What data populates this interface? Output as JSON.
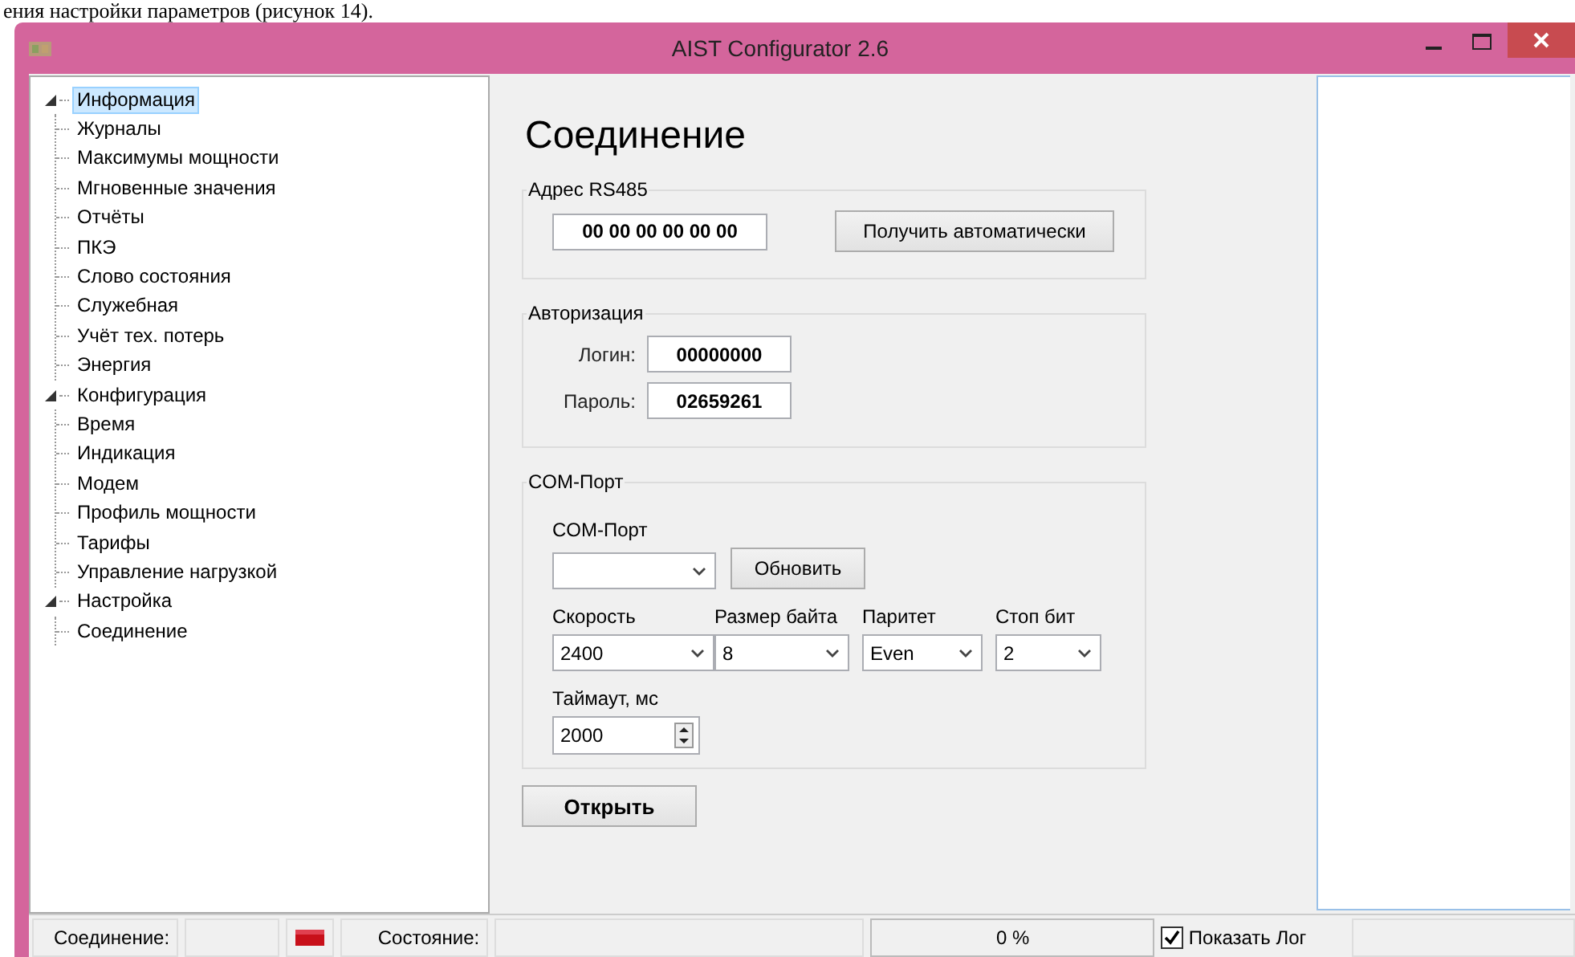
{
  "document_text": "ения настройки параметров (рисунок 14).",
  "window": {
    "title": "AIST Configurator 2.6"
  },
  "tree": [
    {
      "label": "Информация",
      "selected": true,
      "expanded": true,
      "children": [
        {
          "label": "Журналы",
          "selected": false
        },
        {
          "label": "Максимумы мощности",
          "selected": false
        },
        {
          "label": "Мгновенные значения",
          "selected": false
        },
        {
          "label": "Отчёты",
          "selected": false
        },
        {
          "label": "ПКЭ",
          "selected": false
        },
        {
          "label": "Слово состояния",
          "selected": false
        },
        {
          "label": "Служебная",
          "selected": false
        },
        {
          "label": "Учёт тех. потерь",
          "selected": false
        },
        {
          "label": "Энергия",
          "selected": false
        }
      ]
    },
    {
      "label": "Конфигурация",
      "selected": false,
      "expanded": true,
      "children": [
        {
          "label": "Время",
          "selected": false
        },
        {
          "label": "Индикация",
          "selected": false
        },
        {
          "label": "Модем",
          "selected": false
        },
        {
          "label": "Профиль мощности",
          "selected": false
        },
        {
          "label": "Тарифы",
          "selected": false
        },
        {
          "label": "Управление нагрузкой",
          "selected": false
        }
      ]
    },
    {
      "label": "Настройка",
      "selected": false,
      "expanded": true,
      "children": [
        {
          "label": "Соединение",
          "selected": false
        }
      ]
    }
  ],
  "page": {
    "title": "Соединение",
    "rs485_group": {
      "title": "Адрес RS485",
      "address": "00 00 00 00 00 00",
      "button": "Получить автоматически"
    },
    "auth_group": {
      "title": "Авторизация",
      "fields": [
        {
          "label": "Логин:",
          "value": "00000000"
        },
        {
          "label": "Пароль:",
          "value": "02659261"
        }
      ]
    },
    "com_group": {
      "title": "COM-Порт",
      "port_label": "COM-Порт",
      "refresh_button": "Обновить",
      "selects": [
        {
          "label": "Скорость",
          "value": "2400"
        },
        {
          "label": "Размер байта",
          "value": "8"
        },
        {
          "label": "Паритет",
          "value": "Even"
        },
        {
          "label": "Стоп бит",
          "value": "2"
        }
      ],
      "timeout": {
        "label": "Таймаут, мс",
        "value": "2000"
      }
    },
    "open_button": "Открыть"
  },
  "status_bar": {
    "connection_label": "Соединение:",
    "state_label": "Состояние:",
    "progress": {
      "level": 0.0,
      "reading": "0 %"
    },
    "show_log": {
      "label": "Показать Лог",
      "checked": true
    }
  }
}
